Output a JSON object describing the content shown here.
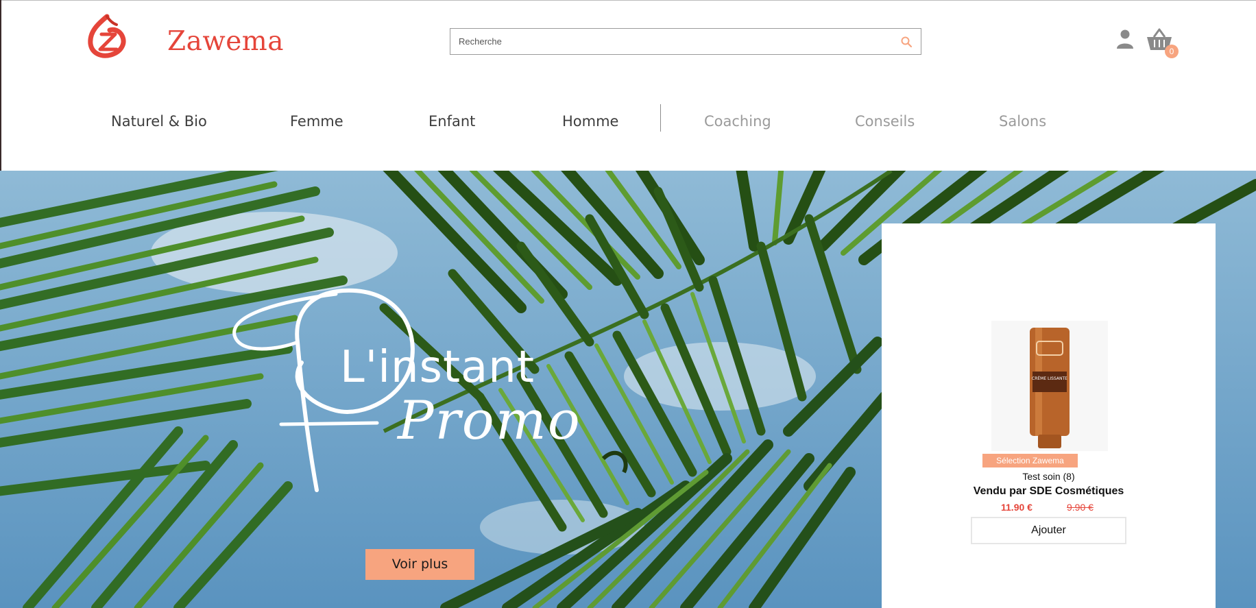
{
  "header": {
    "brand": "Zawema",
    "logo_icon": "zawema-logo-icon",
    "search": {
      "placeholder": "Recherche"
    },
    "cart_count": "0"
  },
  "nav": {
    "items": [
      {
        "label": "Naturel & Bio",
        "muted": false
      },
      {
        "label": "Femme",
        "muted": false
      },
      {
        "label": "Enfant",
        "muted": false
      },
      {
        "label": "Homme",
        "muted": false
      },
      {
        "label": "Coaching",
        "muted": true
      },
      {
        "label": "Conseils",
        "muted": true
      },
      {
        "label": "Salons",
        "muted": true
      }
    ]
  },
  "hero": {
    "title_line1": "L'instant",
    "title_line2": "Promo",
    "cta_label": "Voir plus"
  },
  "product": {
    "badge": "Sélection Zawema",
    "name": "Test soin (8)",
    "seller": "Vendu par SDE Cosmétiques",
    "price_new": "11.90 €",
    "price_old": "9.90 €",
    "add_label": "Ajouter",
    "image_label": "CRÈME LISSANTE"
  },
  "colors": {
    "brand_red": "#e5453a",
    "accent_peach": "#f7a47f"
  }
}
